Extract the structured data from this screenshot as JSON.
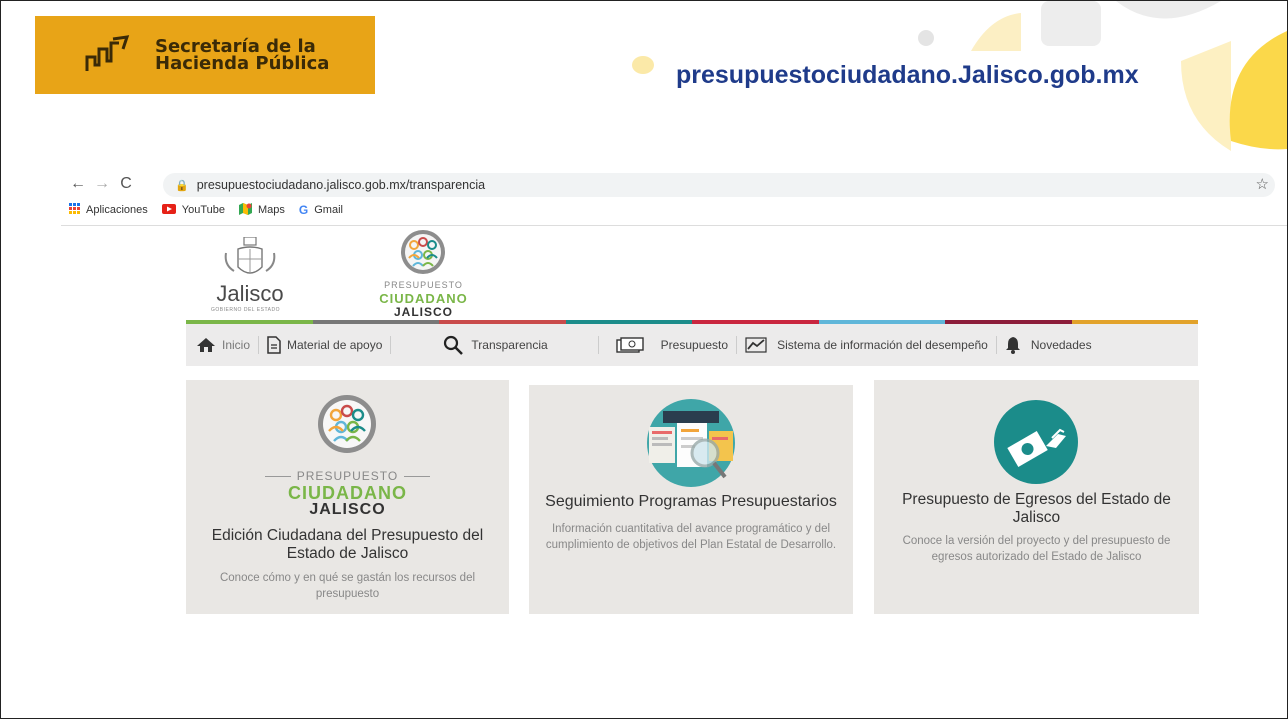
{
  "banner": {
    "org_line1": "Secretaría de la",
    "org_line2": "Hacienda Pública",
    "site_url": "presupuestociudadano.Jalisco.gob.mx",
    "colors": {
      "badge": "#e8a417",
      "url_text": "#1f3b8a"
    }
  },
  "browser": {
    "back_icon": "back-arrow-icon",
    "forward_icon": "forward-arrow-icon",
    "reload_icon": "reload-icon",
    "address": "presupuestociudadano.jalisco.gob.mx/transparencia",
    "bookmarks": [
      {
        "label": "Aplicaciones",
        "icon": "apps-grid-icon"
      },
      {
        "label": "YouTube",
        "icon": "youtube-icon"
      },
      {
        "label": "Maps",
        "icon": "maps-icon"
      },
      {
        "label": "Gmail",
        "icon": "google-icon"
      }
    ]
  },
  "site": {
    "jalisco_logo": {
      "word": "Jalisco",
      "sub": "GOBIERNO DEL ESTADO"
    },
    "pc_logo": {
      "line1": "PRESUPUESTO",
      "line2": "CIUDADANO",
      "line3": "JALISCO"
    },
    "stripe_colors": [
      "#7ab648",
      "#777777",
      "#c94b4b",
      "#1b8c8a",
      "#c9263f",
      "#5fb6d9",
      "#8c1d3a",
      "#e2a22a"
    ],
    "menu": [
      {
        "label": "Inicio",
        "icon": "home-icon"
      },
      {
        "label": "Material de apoyo",
        "icon": "document-icon"
      },
      {
        "label": "Transparencia",
        "icon": "search-icon"
      },
      {
        "label": "Presupuesto",
        "icon": "money-icon"
      },
      {
        "label": "Sistema de información del desempeño",
        "icon": "chart-icon"
      },
      {
        "label": "Novedades",
        "icon": "bell-icon"
      }
    ]
  },
  "cards": [
    {
      "logo_line1": "PRESUPUESTO",
      "logo_line2": "CIUDADANO",
      "logo_line3": "JALISCO",
      "title": "Edición Ciudadana del Presupuesto del Estado de Jalisco",
      "description": "Conoce cómo y en qué se gastán los recursos del presupuesto"
    },
    {
      "title": "Seguimiento Programas Presupuestarios",
      "description": "Información cuantitativa del avance programático y del cumplimiento de objetivos del Plan Estatal de Desarrollo."
    },
    {
      "title": "Presupuesto de Egresos del Estado de Jalisco",
      "description": "Conoce la versión del proyecto y del presupuesto de egresos autorizado del Estado de Jalisco"
    }
  ]
}
